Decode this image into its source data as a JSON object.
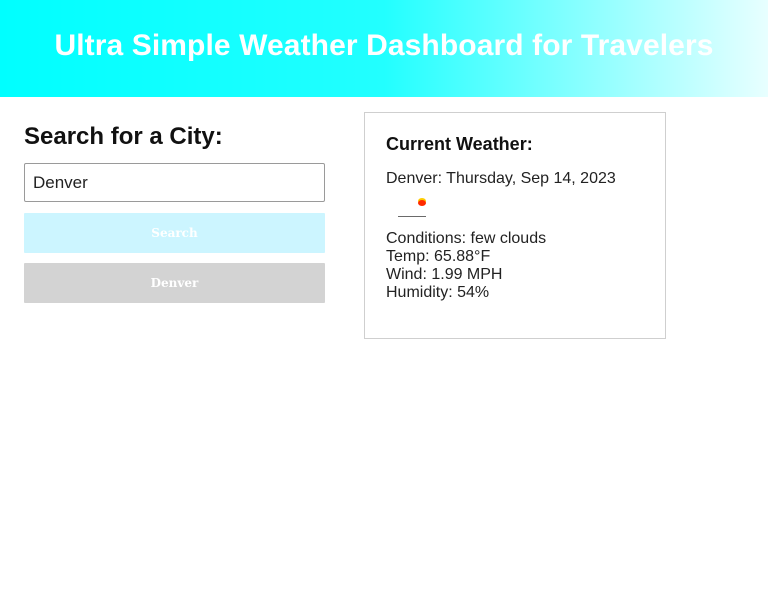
{
  "header": {
    "title": "Ultra Simple Weather Dashboard for Travelers"
  },
  "search": {
    "title": "Search for a City:",
    "input_value": "Denver",
    "search_label": "Search",
    "history": [
      "Denver"
    ]
  },
  "weather": {
    "title": "Current Weather:",
    "city_date": "Denver: Thursday, Sep 14, 2023",
    "icon": "few-clouds-icon",
    "conditions": "Conditions: few clouds",
    "temp": "Temp: 65.88°F",
    "wind": "Wind: 1.99 MPH",
    "humidity": "Humidity: 54%"
  },
  "colors": {
    "header_gradient_start": "#00ffff",
    "header_gradient_end": "#e8ffff",
    "search_button": "#ccf5ff",
    "history_button": "#d3d3d3"
  }
}
